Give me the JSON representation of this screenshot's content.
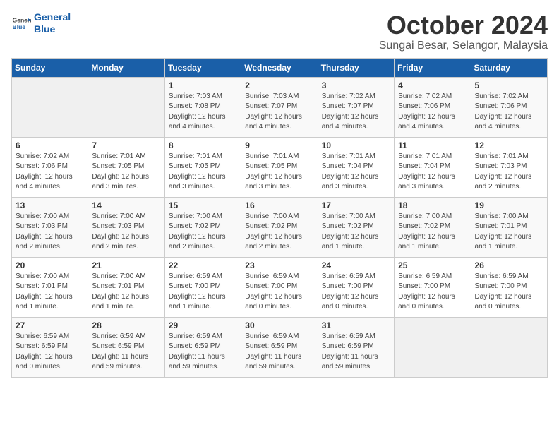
{
  "logo": {
    "line1": "General",
    "line2": "Blue"
  },
  "title": "October 2024",
  "subtitle": "Sungai Besar, Selangor, Malaysia",
  "headers": [
    "Sunday",
    "Monday",
    "Tuesday",
    "Wednesday",
    "Thursday",
    "Friday",
    "Saturday"
  ],
  "weeks": [
    [
      {
        "day": "",
        "info": ""
      },
      {
        "day": "",
        "info": ""
      },
      {
        "day": "1",
        "info": "Sunrise: 7:03 AM\nSunset: 7:08 PM\nDaylight: 12 hours\nand 4 minutes."
      },
      {
        "day": "2",
        "info": "Sunrise: 7:03 AM\nSunset: 7:07 PM\nDaylight: 12 hours\nand 4 minutes."
      },
      {
        "day": "3",
        "info": "Sunrise: 7:02 AM\nSunset: 7:07 PM\nDaylight: 12 hours\nand 4 minutes."
      },
      {
        "day": "4",
        "info": "Sunrise: 7:02 AM\nSunset: 7:06 PM\nDaylight: 12 hours\nand 4 minutes."
      },
      {
        "day": "5",
        "info": "Sunrise: 7:02 AM\nSunset: 7:06 PM\nDaylight: 12 hours\nand 4 minutes."
      }
    ],
    [
      {
        "day": "6",
        "info": "Sunrise: 7:02 AM\nSunset: 7:06 PM\nDaylight: 12 hours\nand 4 minutes."
      },
      {
        "day": "7",
        "info": "Sunrise: 7:01 AM\nSunset: 7:05 PM\nDaylight: 12 hours\nand 3 minutes."
      },
      {
        "day": "8",
        "info": "Sunrise: 7:01 AM\nSunset: 7:05 PM\nDaylight: 12 hours\nand 3 minutes."
      },
      {
        "day": "9",
        "info": "Sunrise: 7:01 AM\nSunset: 7:05 PM\nDaylight: 12 hours\nand 3 minutes."
      },
      {
        "day": "10",
        "info": "Sunrise: 7:01 AM\nSunset: 7:04 PM\nDaylight: 12 hours\nand 3 minutes."
      },
      {
        "day": "11",
        "info": "Sunrise: 7:01 AM\nSunset: 7:04 PM\nDaylight: 12 hours\nand 3 minutes."
      },
      {
        "day": "12",
        "info": "Sunrise: 7:01 AM\nSunset: 7:03 PM\nDaylight: 12 hours\nand 2 minutes."
      }
    ],
    [
      {
        "day": "13",
        "info": "Sunrise: 7:00 AM\nSunset: 7:03 PM\nDaylight: 12 hours\nand 2 minutes."
      },
      {
        "day": "14",
        "info": "Sunrise: 7:00 AM\nSunset: 7:03 PM\nDaylight: 12 hours\nand 2 minutes."
      },
      {
        "day": "15",
        "info": "Sunrise: 7:00 AM\nSunset: 7:02 PM\nDaylight: 12 hours\nand 2 minutes."
      },
      {
        "day": "16",
        "info": "Sunrise: 7:00 AM\nSunset: 7:02 PM\nDaylight: 12 hours\nand 2 minutes."
      },
      {
        "day": "17",
        "info": "Sunrise: 7:00 AM\nSunset: 7:02 PM\nDaylight: 12 hours\nand 1 minute."
      },
      {
        "day": "18",
        "info": "Sunrise: 7:00 AM\nSunset: 7:02 PM\nDaylight: 12 hours\nand 1 minute."
      },
      {
        "day": "19",
        "info": "Sunrise: 7:00 AM\nSunset: 7:01 PM\nDaylight: 12 hours\nand 1 minute."
      }
    ],
    [
      {
        "day": "20",
        "info": "Sunrise: 7:00 AM\nSunset: 7:01 PM\nDaylight: 12 hours\nand 1 minute."
      },
      {
        "day": "21",
        "info": "Sunrise: 7:00 AM\nSunset: 7:01 PM\nDaylight: 12 hours\nand 1 minute."
      },
      {
        "day": "22",
        "info": "Sunrise: 6:59 AM\nSunset: 7:00 PM\nDaylight: 12 hours\nand 1 minute."
      },
      {
        "day": "23",
        "info": "Sunrise: 6:59 AM\nSunset: 7:00 PM\nDaylight: 12 hours\nand 0 minutes."
      },
      {
        "day": "24",
        "info": "Sunrise: 6:59 AM\nSunset: 7:00 PM\nDaylight: 12 hours\nand 0 minutes."
      },
      {
        "day": "25",
        "info": "Sunrise: 6:59 AM\nSunset: 7:00 PM\nDaylight: 12 hours\nand 0 minutes."
      },
      {
        "day": "26",
        "info": "Sunrise: 6:59 AM\nSunset: 7:00 PM\nDaylight: 12 hours\nand 0 minutes."
      }
    ],
    [
      {
        "day": "27",
        "info": "Sunrise: 6:59 AM\nSunset: 6:59 PM\nDaylight: 12 hours\nand 0 minutes."
      },
      {
        "day": "28",
        "info": "Sunrise: 6:59 AM\nSunset: 6:59 PM\nDaylight: 11 hours\nand 59 minutes."
      },
      {
        "day": "29",
        "info": "Sunrise: 6:59 AM\nSunset: 6:59 PM\nDaylight: 11 hours\nand 59 minutes."
      },
      {
        "day": "30",
        "info": "Sunrise: 6:59 AM\nSunset: 6:59 PM\nDaylight: 11 hours\nand 59 minutes."
      },
      {
        "day": "31",
        "info": "Sunrise: 6:59 AM\nSunset: 6:59 PM\nDaylight: 11 hours\nand 59 minutes."
      },
      {
        "day": "",
        "info": ""
      },
      {
        "day": "",
        "info": ""
      }
    ]
  ]
}
